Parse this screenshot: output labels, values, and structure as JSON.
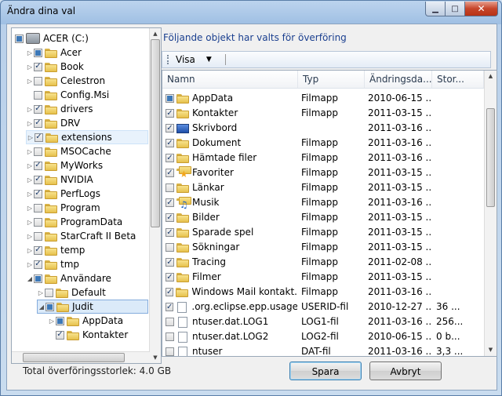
{
  "window": {
    "title": "Ändra dina val",
    "minimize": "▁",
    "maximize": "□",
    "close": "✕"
  },
  "tree": {
    "root": {
      "label": "ACER (C:)",
      "state": "partial"
    },
    "items": [
      {
        "label": "Acer",
        "state": "partial",
        "arrow": "▷",
        "indent": 1
      },
      {
        "label": "Book",
        "state": "checked",
        "arrow": "▷",
        "indent": 1
      },
      {
        "label": "Celestron",
        "state": "unchecked",
        "arrow": "▷",
        "indent": 1
      },
      {
        "label": "Config.Msi",
        "state": "unchecked",
        "arrow": "",
        "indent": 1
      },
      {
        "label": "drivers",
        "state": "checked",
        "arrow": "▷",
        "indent": 1
      },
      {
        "label": "DRV",
        "state": "checked",
        "arrow": "▷",
        "indent": 1
      },
      {
        "label": "extensions",
        "state": "checked",
        "arrow": "▷",
        "indent": 1,
        "hover": true
      },
      {
        "label": "MSOCache",
        "state": "unchecked",
        "arrow": "▷",
        "indent": 1
      },
      {
        "label": "MyWorks",
        "state": "checked",
        "arrow": "▷",
        "indent": 1
      },
      {
        "label": "NVIDIA",
        "state": "checked",
        "arrow": "▷",
        "indent": 1
      },
      {
        "label": "PerfLogs",
        "state": "checked",
        "arrow": "▷",
        "indent": 1
      },
      {
        "label": "Program",
        "state": "unchecked",
        "arrow": "▷",
        "indent": 1
      },
      {
        "label": "ProgramData",
        "state": "unchecked",
        "arrow": "▷",
        "indent": 1
      },
      {
        "label": "StarCraft II Beta",
        "state": "unchecked",
        "arrow": "▷",
        "indent": 1
      },
      {
        "label": "temp",
        "state": "checked",
        "arrow": "▷",
        "indent": 1
      },
      {
        "label": "tmp",
        "state": "checked",
        "arrow": "▷",
        "indent": 1
      },
      {
        "label": "Användare",
        "state": "partial",
        "arrow": "◢",
        "indent": 1
      },
      {
        "label": "Default",
        "state": "unchecked",
        "arrow": "▷",
        "indent": 2
      },
      {
        "label": "Judit",
        "state": "partial",
        "arrow": "◢",
        "indent": 2,
        "selected": true
      },
      {
        "label": "AppData",
        "state": "partial",
        "arrow": "▷",
        "indent": 3
      },
      {
        "label": "Kontakter",
        "state": "checked",
        "arrow": "",
        "indent": 3
      }
    ]
  },
  "right": {
    "header": "Följande objekt har valts för överföring",
    "toolbar": {
      "visa": "Visa",
      "caret": "▼"
    },
    "columns": {
      "name": "Namn",
      "type": "Typ",
      "date": "Ändringsda...",
      "size": "Stor..."
    },
    "rows": [
      {
        "name": "AppData",
        "type": "Filmapp",
        "date": "2010-06-15 ...",
        "size": "",
        "state": "partial",
        "icon": "folder"
      },
      {
        "name": "Kontakter",
        "type": "Filmapp",
        "date": "2011-03-15 ...",
        "size": "",
        "state": "checked",
        "icon": "folder"
      },
      {
        "name": "Skrivbord",
        "type": "",
        "date": "2011-03-16 ...",
        "size": "",
        "state": "checked",
        "icon": "desk"
      },
      {
        "name": "Dokument",
        "type": "Filmapp",
        "date": "2011-03-16 ...",
        "size": "",
        "state": "checked",
        "icon": "folder"
      },
      {
        "name": "Hämtade filer",
        "type": "Filmapp",
        "date": "2011-03-16 ...",
        "size": "",
        "state": "checked",
        "icon": "folder"
      },
      {
        "name": "Favoriter",
        "type": "Filmapp",
        "date": "2011-03-15 ...",
        "size": "",
        "state": "checked",
        "icon": "fav"
      },
      {
        "name": "Länkar",
        "type": "Filmapp",
        "date": "2011-03-15 ...",
        "size": "",
        "state": "unchecked",
        "icon": "folder"
      },
      {
        "name": "Musik",
        "type": "Filmapp",
        "date": "2011-03-16 ...",
        "size": "",
        "state": "checked",
        "icon": "music"
      },
      {
        "name": "Bilder",
        "type": "Filmapp",
        "date": "2011-03-15 ...",
        "size": "",
        "state": "checked",
        "icon": "folder"
      },
      {
        "name": "Sparade spel",
        "type": "Filmapp",
        "date": "2011-03-15 ...",
        "size": "",
        "state": "checked",
        "icon": "folder"
      },
      {
        "name": "Sökningar",
        "type": "Filmapp",
        "date": "2011-03-15 ...",
        "size": "",
        "state": "unchecked",
        "icon": "folder"
      },
      {
        "name": "Tracing",
        "type": "Filmapp",
        "date": "2011-02-08 ...",
        "size": "",
        "state": "checked",
        "icon": "folder"
      },
      {
        "name": "Filmer",
        "type": "Filmapp",
        "date": "2011-03-15 ...",
        "size": "",
        "state": "checked",
        "icon": "folder"
      },
      {
        "name": "Windows Mail kontakt...",
        "type": "Filmapp",
        "date": "2011-03-16 ...",
        "size": "",
        "state": "checked",
        "icon": "folder"
      },
      {
        "name": ".org.eclipse.epp.usage...",
        "type": "USERID-fil",
        "date": "2010-12-27 ...",
        "size": "36 ...",
        "state": "checked",
        "icon": "file"
      },
      {
        "name": "ntuser.dat.LOG1",
        "type": "LOG1-fil",
        "date": "2011-03-16 ...",
        "size": "256...",
        "state": "unchecked",
        "icon": "file"
      },
      {
        "name": "ntuser.dat.LOG2",
        "type": "LOG2-fil",
        "date": "2010-06-15 ...",
        "size": "0 b...",
        "state": "unchecked",
        "icon": "file"
      },
      {
        "name": "ntuser",
        "type": "DAT-fil",
        "date": "2011-03-16 ...",
        "size": "3,3 ...",
        "state": "unchecked",
        "icon": "file"
      }
    ]
  },
  "footer": {
    "total": "Total överföringsstorlek: 4.0 GB",
    "save": "Spara",
    "cancel": "Avbryt"
  }
}
